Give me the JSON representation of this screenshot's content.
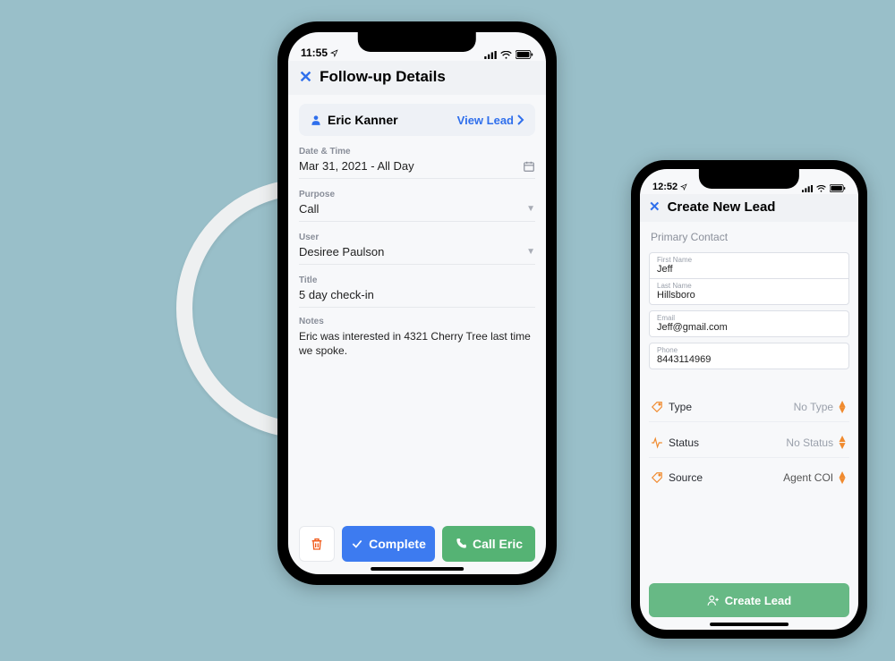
{
  "phone1": {
    "status_time": "11:55",
    "header_title": "Follow-up Details",
    "lead": {
      "name": "Eric Kanner",
      "view_label": "View Lead"
    },
    "fields": {
      "date_label": "Date & Time",
      "date_value": "Mar 31, 2021 - All Day",
      "purpose_label": "Purpose",
      "purpose_value": "Call",
      "user_label": "User",
      "user_value": "Desiree Paulson",
      "title_label": "Title",
      "title_value": "5 day check-in",
      "notes_label": "Notes",
      "notes_value": "Eric was interested in 4321 Cherry Tree last time we spoke."
    },
    "actions": {
      "complete": "Complete",
      "call": "Call Eric"
    }
  },
  "phone2": {
    "status_time": "12:52",
    "header_title": "Create New Lead",
    "section_primary": "Primary Contact",
    "inputs": {
      "first_name_label": "First Name",
      "first_name": "Jeff",
      "last_name_label": "Last Name",
      "last_name": "Hillsboro",
      "email_label": "Email",
      "email": "Jeff@gmail.com",
      "phone_label": "Phone",
      "phone": "8443114969"
    },
    "selects": {
      "type_label": "Type",
      "type_value": "No Type",
      "status_label": "Status",
      "status_value": "No Status",
      "source_label": "Source",
      "source_value": "Agent COI"
    },
    "create_label": "Create Lead"
  }
}
